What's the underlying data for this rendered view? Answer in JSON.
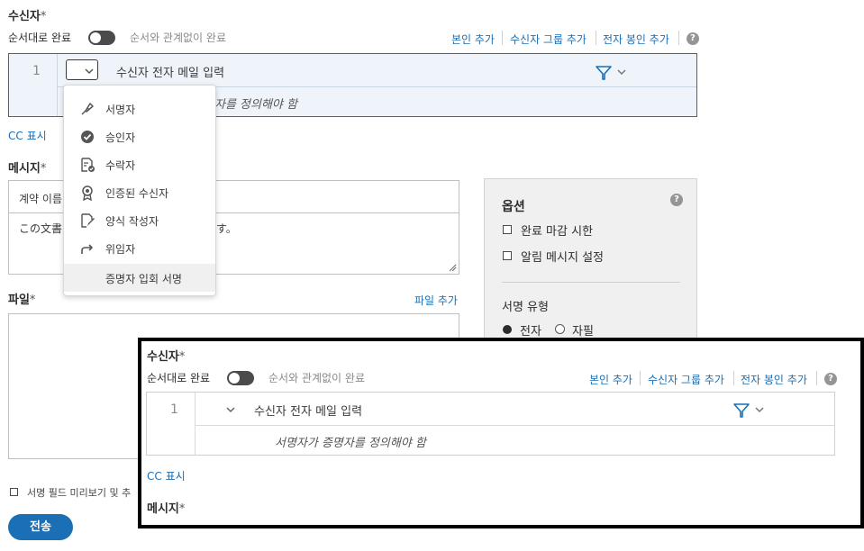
{
  "recipients": {
    "title": "수신자",
    "required_mark": "*",
    "order_label": "순서대로 완료",
    "any_order_label": "순서와 관계없이 완료",
    "add_me": "본인 추가",
    "add_group": "수신자 그룹 추가",
    "add_notary": "전자 봉인 추가",
    "help": "?",
    "row_index": "1",
    "email_placeholder": "수신자 전자 메일 입력",
    "hint_partial": "자를 정의해야 함",
    "hint_full": "서명자가 증명자를 정의해야 함",
    "show_cc": "CC 표시"
  },
  "role_menu": {
    "items": [
      {
        "label": "서명자",
        "icon": "pen-nib-icon"
      },
      {
        "label": "승인자",
        "icon": "check-circle-icon"
      },
      {
        "label": "수락자",
        "icon": "document-check-icon"
      },
      {
        "label": "인증된 수신자",
        "icon": "ribbon-award-icon"
      },
      {
        "label": "양식 작성자",
        "icon": "form-edit-icon"
      },
      {
        "label": "위임자",
        "icon": "forward-arrow-icon"
      },
      {
        "label": "증명자 입회 서명",
        "icon": ""
      }
    ]
  },
  "message": {
    "title": "메시지",
    "required_mark": "*",
    "subject_partial": "계약 이름",
    "body_partial_left": "この文書",
    "body_partial_right": "す。"
  },
  "files": {
    "title": "파일",
    "required_mark": "*",
    "add_file": "파일 추가"
  },
  "options": {
    "title": "옵션",
    "help": "?",
    "deadline": "완료 마감 시한",
    "reminder": "알림 메시지 설정",
    "signature_type": "서명 유형",
    "electronic": "전자",
    "handwritten": "자필"
  },
  "footer": {
    "preview_label": "서명 필드 미리보기 및 추",
    "send": "전송"
  },
  "colors": {
    "accent": "#1a6fb5",
    "zoom_border": "#000000"
  }
}
